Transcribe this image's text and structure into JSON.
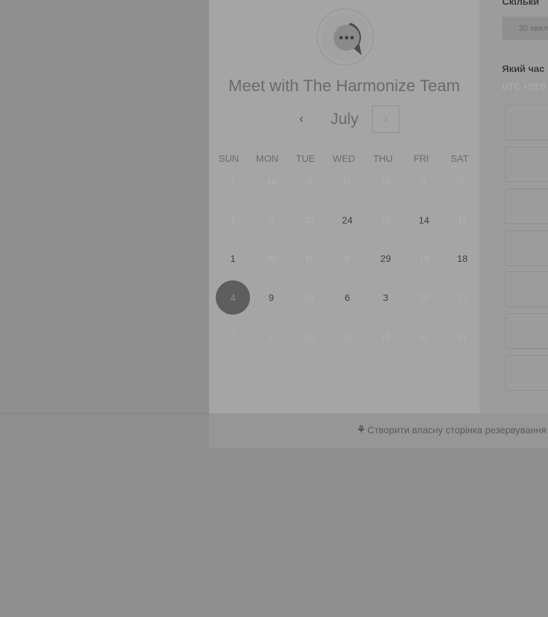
{
  "meeting": {
    "title": "Meet with The Harmonize Team",
    "avatar_icon": "chat-bubble-icon"
  },
  "calendar": {
    "month": "July",
    "prev_icon": "chevron-left-icon",
    "next_icon": "chevron-right-icon",
    "prev_glyph": "‹",
    "next_glyph": "›",
    "weekdays": [
      "SUN",
      "MON",
      "TUE",
      "WED",
      "THU",
      "FRI",
      "SAT"
    ],
    "weeks": [
      [
        {
          "d": "7",
          "s": "off"
        },
        {
          "d": "14",
          "s": "off"
        },
        {
          "d": "5",
          "s": "off"
        },
        {
          "d": "11",
          "s": "off"
        },
        {
          "d": "18",
          "s": "off"
        },
        {
          "d": "4",
          "s": "off"
        },
        {
          "d": "5",
          "s": "off"
        }
      ],
      [
        {
          "d": "3",
          "s": "off"
        },
        {
          "d": "9",
          "s": "off"
        },
        {
          "d": "20",
          "s": "off"
        },
        {
          "d": "24",
          "s": "on"
        },
        {
          "d": "16",
          "s": "off"
        },
        {
          "d": "14",
          "s": "on"
        },
        {
          "d": "15",
          "s": "off"
        }
      ],
      [
        {
          "d": "1",
          "s": "on"
        },
        {
          "d": "30",
          "s": "off"
        },
        {
          "d": "11",
          "s": "off"
        },
        {
          "d": "8",
          "s": "off"
        },
        {
          "d": "29",
          "s": "on"
        },
        {
          "d": "14",
          "s": "off"
        },
        {
          "d": "18",
          "s": "on"
        }
      ],
      [
        {
          "d": "4",
          "s": "selected"
        },
        {
          "d": "9",
          "s": "on"
        },
        {
          "d": "19",
          "s": "off"
        },
        {
          "d": "6",
          "s": "on"
        },
        {
          "d": "3",
          "s": "on"
        },
        {
          "d": "20",
          "s": "off"
        },
        {
          "d": "12",
          "s": "off"
        }
      ],
      [
        {
          "d": "7",
          "s": "off"
        },
        {
          "d": "2",
          "s": "off"
        },
        {
          "d": "20",
          "s": "off"
        },
        {
          "d": "21",
          "s": "off"
        },
        {
          "d": "15",
          "s": "off"
        },
        {
          "d": "11",
          "s": "off"
        },
        {
          "d": "31",
          "s": "off"
        }
      ]
    ]
  },
  "side": {
    "duration_heading": "Скільки",
    "duration_value": "30 хвил",
    "time_heading": "Який час",
    "timezone": "UTC +03:0"
  },
  "footer": {
    "link_icon": "sprocket-icon",
    "link_text": "Створити власну сторінка резервування"
  },
  "colors": {
    "overlay": "#8e8e8e",
    "selected_day": "#5e5e5e"
  }
}
